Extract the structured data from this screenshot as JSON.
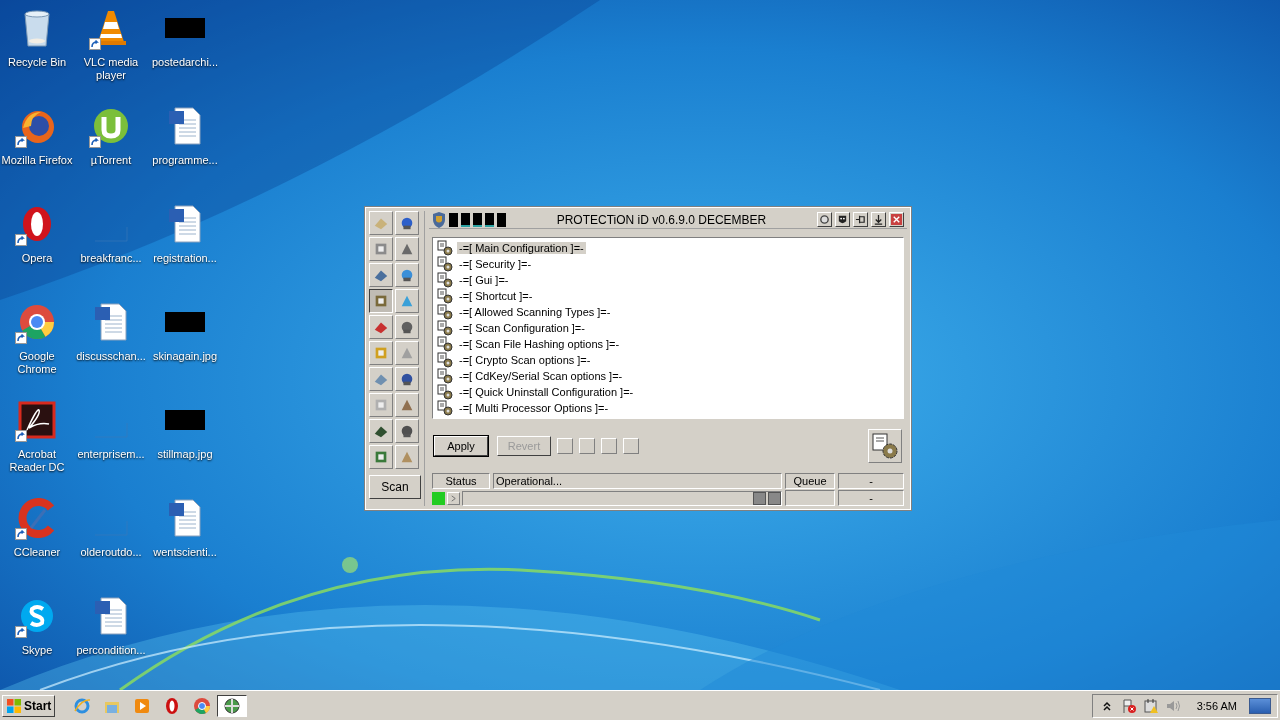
{
  "desktop_icons": [
    {
      "label": "Recycle Bin",
      "kind": "recycle",
      "shortcut": false
    },
    {
      "label": "Mozilla Firefox",
      "kind": "firefox",
      "shortcut": true
    },
    {
      "label": "Opera",
      "kind": "opera",
      "shortcut": true
    },
    {
      "label": "Google Chrome",
      "kind": "chrome",
      "shortcut": true
    },
    {
      "label": "Acrobat Reader DC",
      "kind": "acrobat",
      "shortcut": true
    },
    {
      "label": "CCleaner",
      "kind": "ccleaner",
      "shortcut": true
    },
    {
      "label": "Skype",
      "kind": "skype",
      "shortcut": true
    },
    {
      "label": "VLC media player",
      "kind": "vlc",
      "shortcut": true
    },
    {
      "label": "µTorrent",
      "kind": "utorrent",
      "shortcut": true
    },
    {
      "label": "breakfranc...",
      "kind": "blank",
      "shortcut": false
    },
    {
      "label": "discusschan...",
      "kind": "word",
      "shortcut": false
    },
    {
      "label": "enterprisem...",
      "kind": "blank",
      "shortcut": false
    },
    {
      "label": "olderoutdo...",
      "kind": "blank",
      "shortcut": false
    },
    {
      "label": "percondition...",
      "kind": "word",
      "shortcut": false
    },
    {
      "label": "postedarchi...",
      "kind": "thumb",
      "shortcut": false
    },
    {
      "label": "programme...",
      "kind": "word",
      "shortcut": false
    },
    {
      "label": "registration...",
      "kind": "word",
      "shortcut": false
    },
    {
      "label": "skinagain.jpg",
      "kind": "thumb",
      "shortcut": false
    },
    {
      "label": "stillmap.jpg",
      "kind": "thumb",
      "shortcut": false
    },
    {
      "label": "wentscienti...",
      "kind": "word",
      "shortcut": false
    }
  ],
  "app_window": {
    "title": "PROTECTiON iD v0.6.9.0 DECEMBER",
    "indicators": [
      {
        "lit": false
      },
      {
        "lit": true
      },
      {
        "lit": true
      },
      {
        "lit": true
      },
      {
        "lit": false
      }
    ],
    "title_buttons": [
      {
        "kind": "search"
      },
      {
        "kind": "mask"
      },
      {
        "kind": "pin"
      },
      {
        "kind": "download"
      },
      {
        "kind": "close"
      }
    ],
    "toolbar": [
      {
        "selected": false
      },
      {
        "selected": false
      },
      {
        "selected": false
      },
      {
        "selected": false
      },
      {
        "selected": false
      },
      {
        "selected": false
      },
      {
        "selected": true
      },
      {
        "selected": false
      },
      {
        "selected": false
      },
      {
        "selected": false
      },
      {
        "selected": false
      },
      {
        "selected": false
      },
      {
        "selected": false
      },
      {
        "selected": false
      },
      {
        "selected": false
      },
      {
        "selected": false
      },
      {
        "selected": false
      },
      {
        "selected": false
      },
      {
        "selected": false
      },
      {
        "selected": false
      }
    ],
    "scan_button": "Scan",
    "config_sections": [
      {
        "label": "-=[ Main Configuration ]=-",
        "selected": true
      },
      {
        "label": "-=[ Security ]=-",
        "selected": false
      },
      {
        "label": "-=[ Gui ]=-",
        "selected": false
      },
      {
        "label": "-=[ Shortcut ]=-",
        "selected": false
      },
      {
        "label": "-=[ Allowed Scanning Types ]=-",
        "selected": false
      },
      {
        "label": "-=[ Scan Configuration ]=-",
        "selected": false
      },
      {
        "label": "-=[ Scan File Hashing options ]=-",
        "selected": false
      },
      {
        "label": "-=[ Crypto Scan options ]=-",
        "selected": false
      },
      {
        "label": "-=[ CdKey/Serial Scan options ]=-",
        "selected": false
      },
      {
        "label": "-=[ Quick Uninstall Configuration ]=-",
        "selected": false
      },
      {
        "label": "-=[ Multi Processor Options ]=-",
        "selected": false
      }
    ],
    "action_buttons": [
      {
        "label": "Apply",
        "disabled": false
      },
      {
        "label": "Revert",
        "disabled": true
      }
    ],
    "status_bar": {
      "status_label": "Status",
      "status_value": "Operational...",
      "queue_label": "Queue",
      "queue_value": "-",
      "column_4": "-",
      "led_on": true
    }
  },
  "taskbar": {
    "start": "Start",
    "pinned": [
      {
        "kind": "ie"
      },
      {
        "kind": "explorer"
      },
      {
        "kind": "media"
      },
      {
        "kind": "opera"
      },
      {
        "kind": "chrome"
      }
    ],
    "running": [
      {
        "selected": true
      }
    ],
    "tray": [
      {
        "kind": "chevron"
      },
      {
        "kind": "flag"
      },
      {
        "kind": "power"
      },
      {
        "kind": "speaker"
      }
    ],
    "clock": "3:56 AM"
  }
}
